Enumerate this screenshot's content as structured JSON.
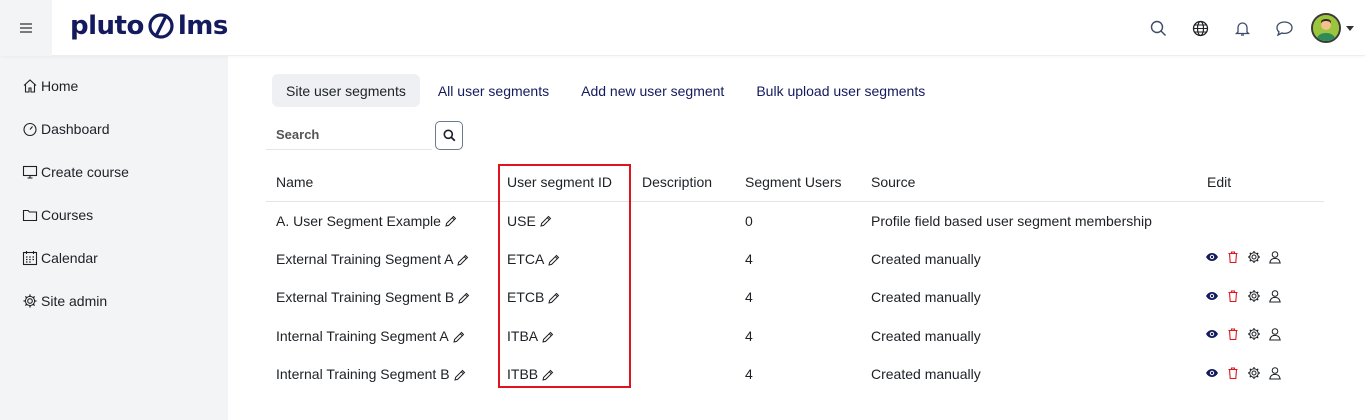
{
  "brand": {
    "name_left": "pluto",
    "name_right": "lms"
  },
  "topbar": {
    "icons": [
      "search-icon",
      "globe-icon",
      "bell-icon",
      "chat-icon",
      "avatar",
      "caret-down-icon"
    ]
  },
  "sidebar": {
    "items": [
      {
        "label": "Home",
        "icon": "home-icon"
      },
      {
        "label": "Dashboard",
        "icon": "gauge-icon"
      },
      {
        "label": "Create course",
        "icon": "monitor-icon"
      },
      {
        "label": "Courses",
        "icon": "folder-icon"
      },
      {
        "label": "Calendar",
        "icon": "calendar-icon"
      },
      {
        "label": "Site admin",
        "icon": "gear-icon"
      }
    ]
  },
  "tabs": [
    {
      "label": "Site user segments",
      "active": true
    },
    {
      "label": "All user segments",
      "active": false
    },
    {
      "label": "Add new user segment",
      "active": false
    },
    {
      "label": "Bulk upload user segments",
      "active": false
    }
  ],
  "search": {
    "placeholder": "Search"
  },
  "table": {
    "headers": [
      "Name",
      "User segment ID",
      "Description",
      "Segment Users",
      "Source",
      "Edit"
    ],
    "rows": [
      {
        "name": "A. User Segment Example",
        "id": "USE",
        "description": "",
        "users": "0",
        "source": "Profile field based user segment membership",
        "actions": false
      },
      {
        "name": "External Training Segment A",
        "id": "ETCA",
        "description": "",
        "users": "4",
        "source": "Created manually",
        "actions": true
      },
      {
        "name": "External Training Segment B",
        "id": "ETCB",
        "description": "",
        "users": "4",
        "source": "Created manually",
        "actions": true
      },
      {
        "name": "Internal Training Segment A",
        "id": "ITBA",
        "description": "",
        "users": "4",
        "source": "Created manually",
        "actions": true
      },
      {
        "name": "Internal Training Segment B",
        "id": "ITBB",
        "description": "",
        "users": "4",
        "source": "Created manually",
        "actions": true
      }
    ]
  },
  "colors": {
    "brand": "#141a5e",
    "highlight": "#e0141e",
    "delete": "#e0141e",
    "view": "#141a5e"
  }
}
